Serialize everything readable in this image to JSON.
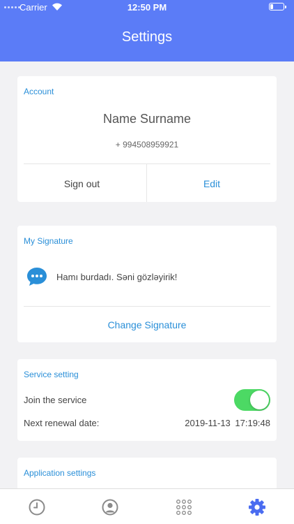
{
  "status_bar": {
    "carrier": "Carrier",
    "time": "12:50 PM"
  },
  "header": {
    "title": "Settings"
  },
  "account": {
    "section_title": "Account",
    "name": "Name Surname",
    "phone": "+ 994508959921",
    "sign_out_label": "Sign out",
    "edit_label": "Edit"
  },
  "signature": {
    "section_title": "My Signature",
    "text": "Hamı burdadı. Səni gözləyirik!",
    "change_label": "Change Signature"
  },
  "service": {
    "section_title": "Service setting",
    "join_label": "Join the service",
    "join_enabled": true,
    "renewal_label": "Next renewal date:",
    "renewal_value": "2019-11-13  17:19:48"
  },
  "application": {
    "section_title": "Application settings"
  },
  "tabbar": {
    "items": [
      {
        "icon": "clock-icon",
        "active": false
      },
      {
        "icon": "person-icon",
        "active": false
      },
      {
        "icon": "dialpad-icon",
        "active": false
      },
      {
        "icon": "gear-icon",
        "active": true
      }
    ]
  },
  "colors": {
    "header": "#5b7cf7",
    "accent": "#2a8fd8",
    "toggle_on": "#4cd964",
    "tab_inactive": "#8a8a8a",
    "tab_active": "#4a6cf0"
  }
}
